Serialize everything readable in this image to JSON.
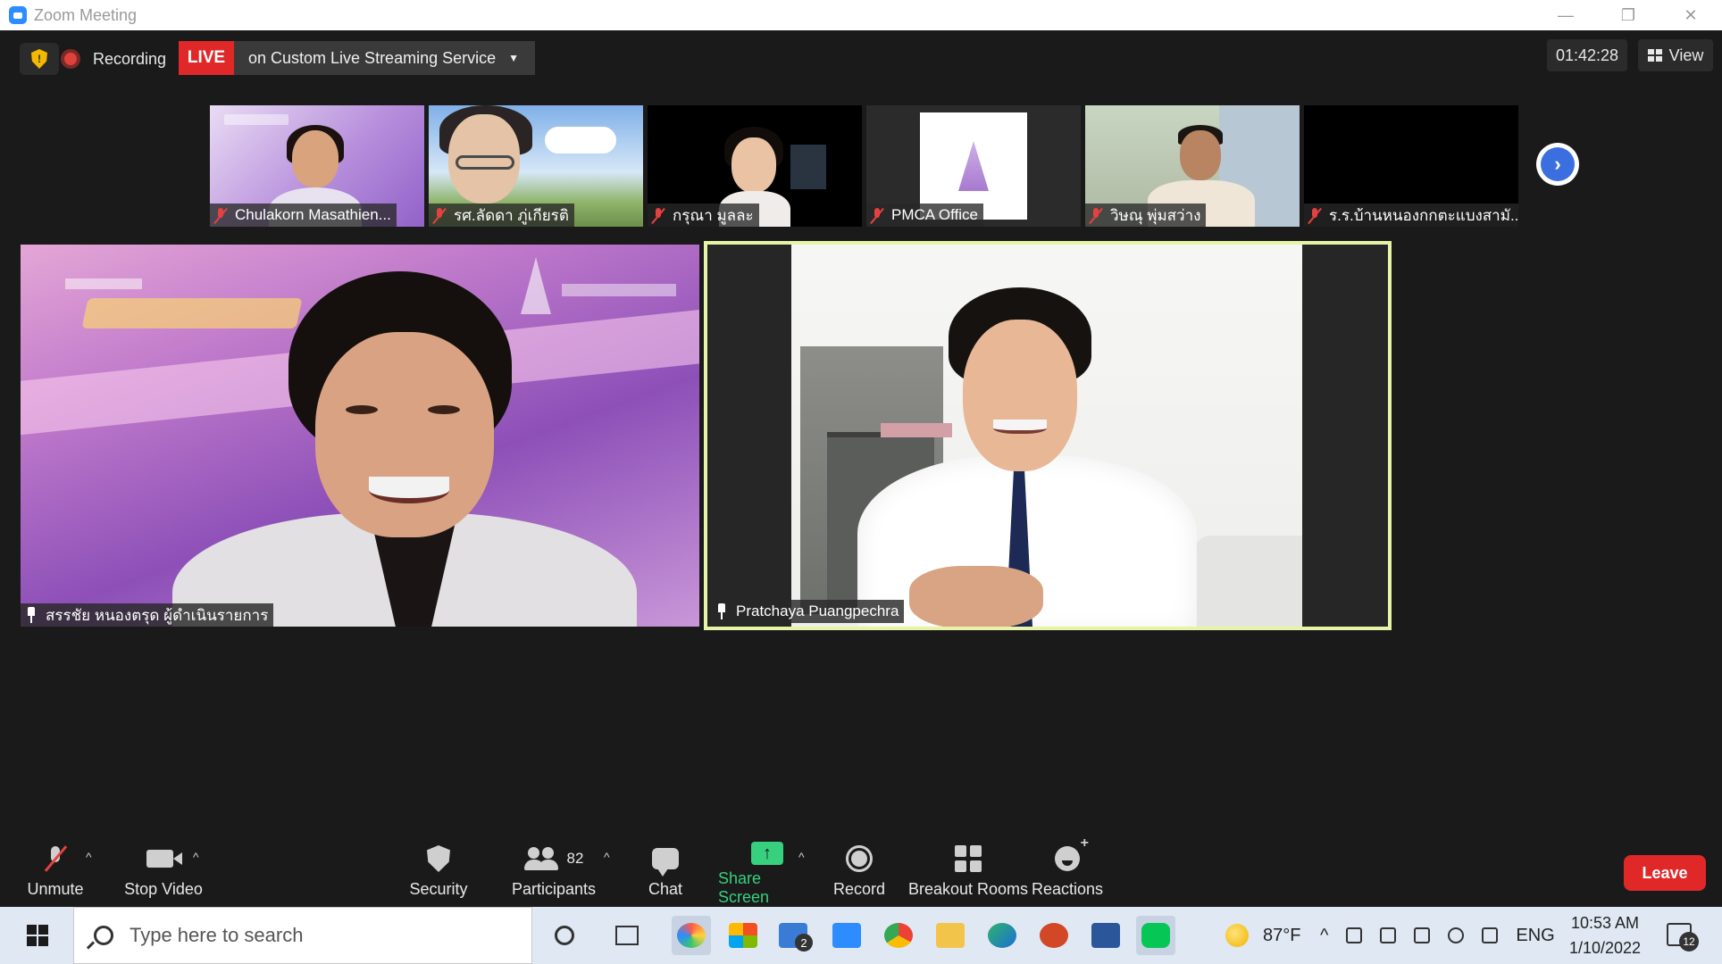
{
  "window": {
    "title": "Zoom Meeting"
  },
  "topbar": {
    "recording_label": "Recording",
    "live_label": "LIVE",
    "stream_service": "on Custom Live Streaming Service",
    "timer": "01:42:28",
    "view_label": "View"
  },
  "thumbnails": [
    {
      "name": "Chulakorn Masathien..."
    },
    {
      "name": "รศ.ลัดดา ภู่เกียรติ"
    },
    {
      "name": "กรุณา มูลละ"
    },
    {
      "name": "PMCA Office"
    },
    {
      "name": "วิษณุ พุ่มสว่าง"
    },
    {
      "name": "ร.ร.บ้านหนองกกตะแบงสามั..."
    }
  ],
  "speakers": [
    {
      "name": "สรรชัย หนองตรุด ผู้ดำเนินรายการ"
    },
    {
      "name": "Pratchaya Puangpechra"
    }
  ],
  "toolbar": {
    "unmute": "Unmute",
    "stop_video": "Stop Video",
    "security": "Security",
    "participants": "Participants",
    "participants_count": "82",
    "chat": "Chat",
    "share_screen": "Share Screen",
    "record": "Record",
    "breakout_rooms": "Breakout Rooms",
    "reactions": "Reactions",
    "leave": "Leave"
  },
  "taskbar": {
    "search_placeholder": "Type here to search",
    "mail_badge": "2",
    "weather": "87°F",
    "language": "ENG",
    "time": "10:53 AM",
    "date": "1/10/2022",
    "notifications": "12"
  },
  "colors": {
    "live_red": "#e02828",
    "share_green": "#36d07e",
    "active_speaker_border": "#e8f3a8"
  }
}
